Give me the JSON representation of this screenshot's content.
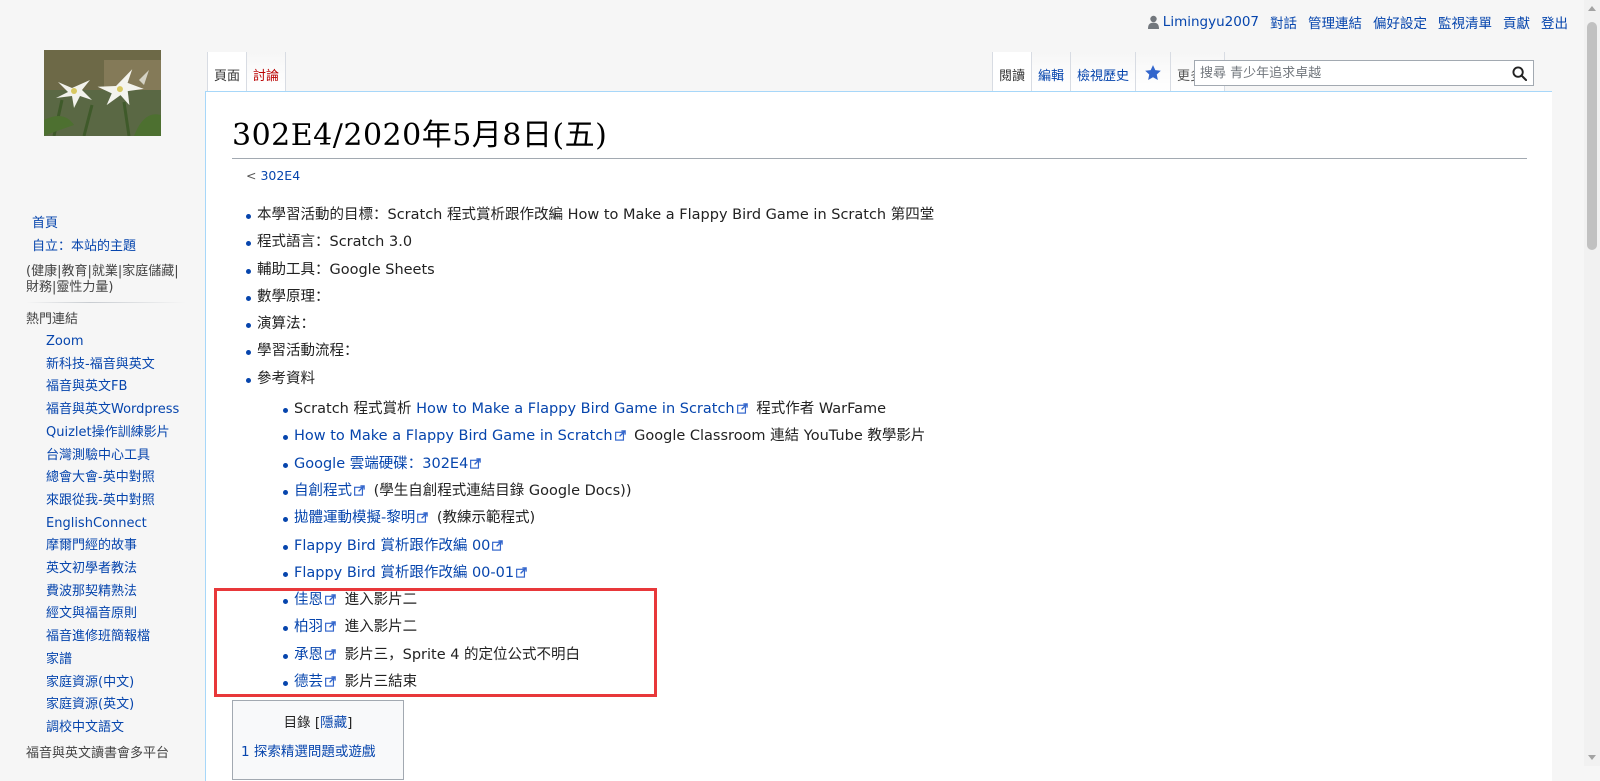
{
  "personal": {
    "user": "Limingyu2007",
    "links": [
      "對話",
      "管理連結",
      "偏好設定",
      "監視清單",
      "貢獻",
      "登出"
    ]
  },
  "tabs_left": [
    "頁面",
    "討論"
  ],
  "tabs_right": {
    "read": "閱讀",
    "edit": "編輯",
    "history": "檢視歷史",
    "more": "更多"
  },
  "search": {
    "placeholder": "搜尋 青少年追求卓越"
  },
  "sidebar": {
    "nav": [
      "首頁",
      "自立：本站的主題"
    ],
    "tagline": "(健康|教育|就業|家庭儲藏|財務|靈性力量)",
    "portal_heading": "熱門連結",
    "portal_links": [
      "Zoom",
      "新科技-福音與英文",
      "福音與英文FB",
      "福音與英文Wordpress",
      "Quizlet操作訓練影片",
      "台灣測驗中心工具",
      "總會大會-英中對照",
      "來跟從我-英中對照",
      "EnglishConnect",
      "摩爾門經的故事",
      "英文初學者教法",
      "費波那契精熟法",
      "經文與福音原則",
      "福音進修班簡報檔",
      "家譜",
      "家庭資源(中文)",
      "家庭資源(英文)",
      "調校中文語文"
    ],
    "bottom_heading": "福音與英文讀書會多平台"
  },
  "page": {
    "title": "302E4/2020年5月8日(五)",
    "breadcrumb_prefix": "< ",
    "breadcrumb_link": "302E4"
  },
  "content": {
    "i1": {
      "label": "本學習活動的目標：",
      "text": "Scratch 程式賞析跟作改編 How to Make a Flappy Bird Game in Scratch 第四堂"
    },
    "i2": "程式語言：Scratch 3.0",
    "i3": "輔助工具：Google Sheets",
    "i4": "數學原理：",
    "i5": "演算法：",
    "i6": "學習活動流程：",
    "i7": "參考資料",
    "r1": {
      "pre": "Scratch 程式賞析 ",
      "link": "How to Make a Flappy Bird Game in Scratch",
      "post": " 程式作者 WarFame"
    },
    "r2": {
      "link": "How to Make a Flappy Bird Game in Scratch",
      "post": " Google Classroom 連結 YouTube 教學影片"
    },
    "r3": {
      "link": "Google 雲端硬碟：302E4"
    },
    "r4": {
      "link": "自創程式",
      "post": " (學生自創程式連結目錄 Google Docs))"
    },
    "r5": {
      "link": "拋體運動模擬-黎明",
      "post": " (教練示範程式)"
    },
    "r6": {
      "link": "Flappy Bird 賞析跟作改編 00"
    },
    "r7": {
      "link": "Flappy Bird 賞析跟作改編 00-01"
    },
    "r8": {
      "link": "佳恩",
      "post": " 進入影片二"
    },
    "r9": {
      "link": "柏羽",
      "post": " 進入影片二"
    },
    "r10": {
      "link": "承恩",
      "post": " 影片三，Sprite 4 的定位公式不明白"
    },
    "r11": {
      "link": "德芸",
      "post": " 影片三結束"
    }
  },
  "toc": {
    "title": "目錄",
    "toggle_open": "[",
    "toggle": "隱藏",
    "toggle_close": "]",
    "first_item_num": "1",
    "first_item": "探索精選問題或遊戲"
  },
  "colors": {
    "link": "#0645ad",
    "highlight_box": "#e8383a",
    "content_border": "#a7d7f9"
  }
}
